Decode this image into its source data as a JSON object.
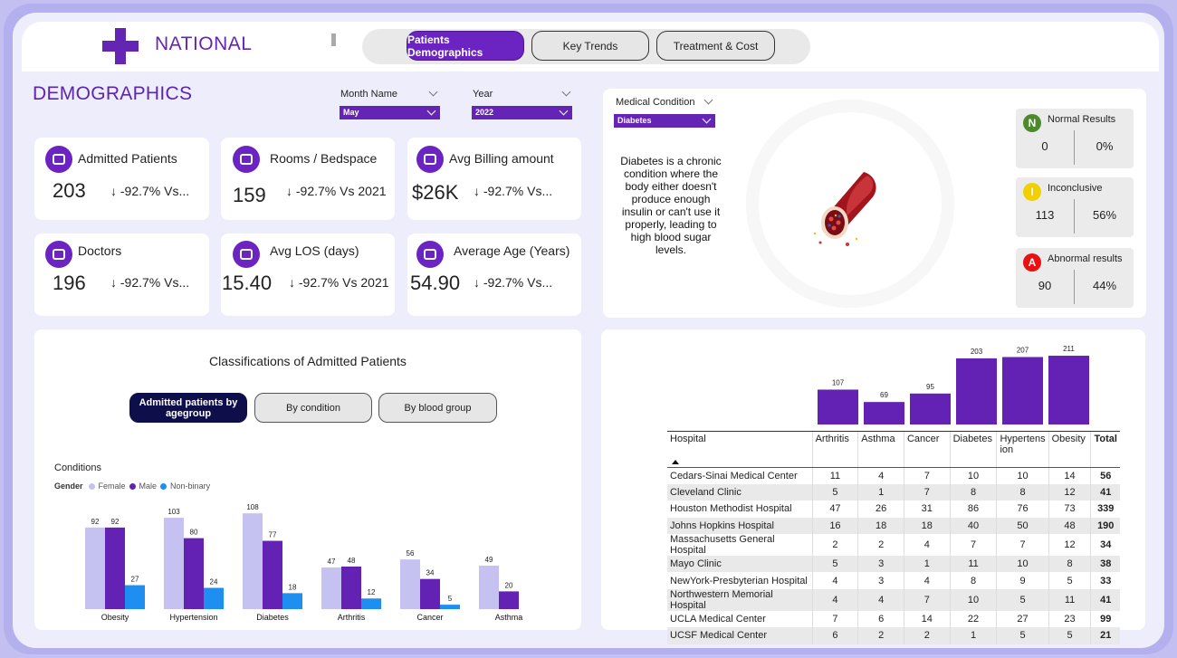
{
  "header": {
    "brand": "NATIONAL",
    "nav": [
      "Patients Demographics",
      "Key Trends",
      "Treatment & Cost"
    ],
    "active_nav": "Patients Demographics"
  },
  "section_title": "DEMOGRAPHICS",
  "filters": {
    "month": {
      "label": "Month Name",
      "value": "May"
    },
    "year": {
      "label": "Year",
      "value": "2022"
    },
    "condition": {
      "label": "Medical Condition",
      "value": "Diabetes"
    }
  },
  "kpis": [
    {
      "title": "Admitted Patients",
      "value": "203",
      "delta": "↓ -92.7% Vs...",
      "icon": "patient-bed-icon"
    },
    {
      "title": "Rooms / Bedspace",
      "value": "159",
      "delta": "↓ -92.7% Vs 2021",
      "icon": "bed-icon"
    },
    {
      "title": "Avg Billing amount",
      "value": "$26K",
      "delta": "↓ -92.7% Vs...",
      "icon": "money-bag-icon"
    },
    {
      "title": "Doctors",
      "value": "196",
      "delta": "↓ -92.7% Vs...",
      "icon": "doctor-icon"
    },
    {
      "title": "Avg LOS (days)",
      "value": "15.40",
      "delta": "↓ -92.7% Vs 2021",
      "icon": "calendar-icon"
    },
    {
      "title": "Average Age (Years)",
      "value": "54.90",
      "delta": "↓ -92.7% Vs...",
      "icon": "people-icon"
    }
  ],
  "condition_description": "Diabetes is a chronic condition where the body either doesn't produce enough insulin or can't use it properly, leading to high blood sugar levels.",
  "results": [
    {
      "badge": "N",
      "title": "Normal Results",
      "count": "0",
      "pct": "0%",
      "color": "#4a8a2a",
      "text_color": "#ffffff"
    },
    {
      "badge": "I",
      "title": "Inconclusive",
      "count": "113",
      "pct": "56%",
      "color": "#f2d000",
      "text_color": "#ffffff"
    },
    {
      "badge": "A",
      "title": "Abnormal results",
      "count": "90",
      "pct": "44%",
      "color": "#e81010",
      "text_color": "#ffffff"
    }
  ],
  "classification": {
    "title": "Classifications of Admitted Patients",
    "tabs": [
      "Admitted patients by agegroup",
      "By condition",
      "By blood group"
    ],
    "active_tab": "Admitted patients by agegroup"
  },
  "colors": {
    "accent": "#6b24c2",
    "female": "#c5c2f2",
    "male": "#6322b4",
    "nonbinary": "#1e8ff0"
  },
  "chart_data": [
    {
      "type": "bar",
      "title": "Conditions",
      "legend_title": "Gender",
      "categories": [
        "Obesity",
        "Hypertension",
        "Diabetes",
        "Arthritis",
        "Cancer",
        "Asthma"
      ],
      "series": [
        {
          "name": "Female",
          "values": [
            92,
            103,
            108,
            47,
            56,
            49
          ]
        },
        {
          "name": "Male",
          "values": [
            92,
            80,
            77,
            48,
            34,
            20
          ]
        },
        {
          "name": "Non-binary",
          "values": [
            27,
            24,
            18,
            12,
            5,
            null
          ]
        }
      ],
      "legend": "top-left",
      "grid": false
    },
    {
      "type": "bar",
      "categories": [
        "Arthritis",
        "Asthma",
        "Cancer",
        "Diabetes",
        "Hypertension",
        "Obesity"
      ],
      "values": [
        107,
        69,
        95,
        203,
        207,
        211
      ],
      "grid": false
    }
  ],
  "hospital_table": {
    "columns": [
      "Hospital",
      "Arthritis",
      "Asthma",
      "Cancer",
      "Diabetes",
      "Hypertens ion",
      "Obesity",
      "Total"
    ],
    "rows": [
      [
        "Cedars-Sinai Medical Center",
        "11",
        "4",
        "7",
        "10",
        "10",
        "14",
        "56"
      ],
      [
        "Cleveland Clinic",
        "5",
        "1",
        "7",
        "8",
        "8",
        "12",
        "41"
      ],
      [
        "Houston Methodist Hospital",
        "47",
        "26",
        "31",
        "86",
        "76",
        "73",
        "339"
      ],
      [
        "Johns Hopkins Hospital",
        "16",
        "18",
        "18",
        "40",
        "50",
        "48",
        "190"
      ],
      [
        "Massachusetts General Hospital",
        "2",
        "2",
        "4",
        "7",
        "7",
        "12",
        "34"
      ],
      [
        "Mayo Clinic",
        "5",
        "3",
        "1",
        "11",
        "10",
        "8",
        "38"
      ],
      [
        "NewYork-Presbyterian Hospital",
        "4",
        "3",
        "4",
        "8",
        "9",
        "5",
        "33"
      ],
      [
        "Northwestern Memorial Hospital",
        "4",
        "4",
        "7",
        "10",
        "5",
        "11",
        "41"
      ],
      [
        "UCLA Medical Center",
        "7",
        "6",
        "14",
        "22",
        "27",
        "23",
        "99"
      ],
      [
        "UCSF Medical Center",
        "6",
        "2",
        "2",
        "1",
        "5",
        "5",
        "21"
      ]
    ]
  }
}
